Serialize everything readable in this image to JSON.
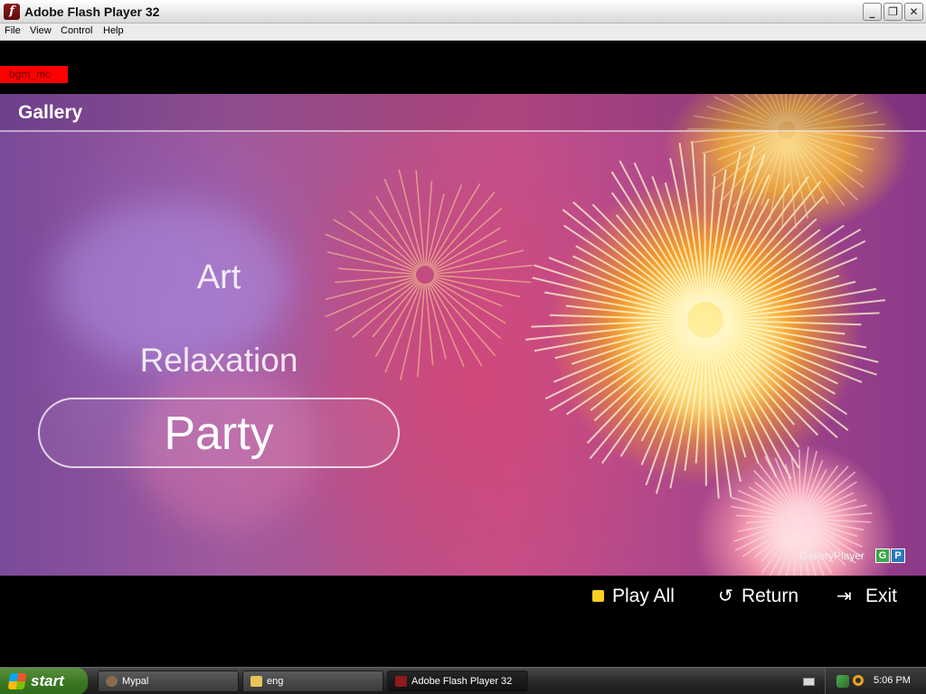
{
  "window": {
    "title": "Adobe Flash Player 32",
    "app_icon_glyph": "f",
    "buttons": {
      "minimize": "_",
      "restore": "❐",
      "close": "✕"
    }
  },
  "menu": [
    "File",
    "View",
    "Control",
    "Help"
  ],
  "stage": {
    "debug_label": "bgm_mc",
    "header_title": "Gallery",
    "categories": [
      "Art",
      "Relaxation",
      "Party"
    ],
    "selected_category": "Party",
    "branding": {
      "name": "GalleryPlayer",
      "badge_g": "G",
      "badge_p": "P"
    },
    "controls": {
      "play_all": "Play All",
      "return": "Return",
      "exit": "Exit"
    },
    "icons": {
      "play_all": "yellow-square-icon",
      "return": "return-arrow-icon",
      "exit": "exit-door-icon"
    }
  },
  "taskbar": {
    "start_label": "start",
    "tasks": [
      {
        "label": "Mypal",
        "icon": "mypal-icon"
      },
      {
        "label": "eng",
        "icon": "folder-icon"
      },
      {
        "label": "Adobe Flash Player 32",
        "icon": "flash-icon",
        "active": true
      }
    ],
    "clock": "5:06 PM"
  },
  "colors": {
    "selection_border": "#ffffff",
    "play_all_square": "#f7d020",
    "debug_tag": "#ff0000",
    "start_button": "#3b7a24",
    "taskbar": "#2a2a2a"
  }
}
